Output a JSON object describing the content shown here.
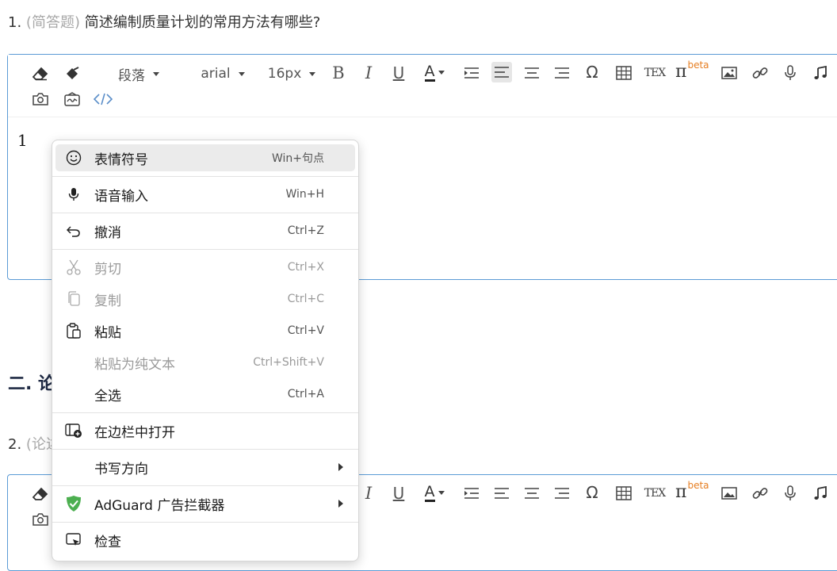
{
  "question1": {
    "number": "1.",
    "type_tag": "(简答题)",
    "text": "简述编制质量计划的常用方法有哪些?"
  },
  "section2": {
    "title": "二. 论"
  },
  "question2": {
    "number": "2.",
    "type_tag": "(论述"
  },
  "toolbar": {
    "paragraph_label": "段落",
    "font_label": "arial",
    "size_label": "16px",
    "bold": "B",
    "italic": "I",
    "underline": "U",
    "font_color": "A",
    "omega": "Ω",
    "tex": "TEX",
    "pi": "π",
    "beta": "beta"
  },
  "editor1": {
    "content": "1"
  },
  "context_menu": {
    "items": [
      {
        "icon": "smiley-icon",
        "label": "表情符号",
        "shortcut": "Win+句点"
      },
      {
        "icon": "microphone-icon",
        "label": "语音输入",
        "shortcut": "Win+H"
      },
      {
        "icon": "undo-icon",
        "label": "撤消",
        "shortcut": "Ctrl+Z"
      },
      {
        "icon": "scissors-icon",
        "label": "剪切",
        "shortcut": "Ctrl+X"
      },
      {
        "icon": "copy-icon",
        "label": "复制",
        "shortcut": "Ctrl+C"
      },
      {
        "icon": "clipboard-icon",
        "label": "粘贴",
        "shortcut": "Ctrl+V"
      },
      {
        "icon": "",
        "label": "粘贴为纯文本",
        "shortcut": "Ctrl+Shift+V"
      },
      {
        "icon": "",
        "label": "全选",
        "shortcut": "Ctrl+A"
      },
      {
        "icon": "sidebar-open-icon",
        "label": "在边栏中打开",
        "shortcut": ""
      },
      {
        "icon": "",
        "label": "书写方向",
        "shortcut": ""
      },
      {
        "icon": "adguard-shield-icon",
        "label": "AdGuard 广告拦截器",
        "shortcut": ""
      },
      {
        "icon": "inspect-icon",
        "label": "检查",
        "shortcut": ""
      }
    ],
    "highlighted_item": "表情符号",
    "disabled_items": [
      "剪切",
      "复制",
      "粘贴为纯文本"
    ]
  },
  "colors": {
    "accent_border": "#5b9bd5",
    "beta_orange": "#e67e22",
    "adguard_green": "#4caf50"
  }
}
